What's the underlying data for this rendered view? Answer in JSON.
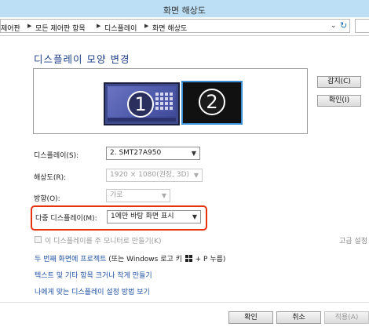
{
  "window": {
    "title": "화면 해상도"
  },
  "address_bar": {
    "crumbs": [
      "제어판",
      "모든 제어판 항목",
      "디스플레이",
      "화면 해상도"
    ]
  },
  "page": {
    "title": "디스플레이 모양 변경",
    "monitors": [
      {
        "number": "1"
      },
      {
        "number": "2"
      }
    ],
    "detect_label": "감지(C)",
    "identify_label": "확인(I)",
    "display_label": "디스플레이(S):",
    "display_value": "2. SMT27A950",
    "resolution_label": "해상도(R):",
    "resolution_value": "1920 × 1080(권장, 3D)",
    "orientation_label": "방향(O):",
    "orientation_value": "가로",
    "multi_display_label": "다중 디스플레이(M):",
    "multi_display_value": "1에만 바탕 화면 표시",
    "main_monitor_label": "이 디스플레이를 주 모니터로 만들기(K)",
    "advanced_label": "고급 설정",
    "links": {
      "project_link": "두 번째 화면에 프로젝트",
      "project_tail": " (또는 Windows 로고 키 ",
      "project_end": " + P 누름)",
      "text_size_link": "텍스트 및 기타 항목 크거나 작게 만들기",
      "help_link": "나에게 맞는 디스플레이 설정 방법 보기"
    }
  },
  "footer": {
    "ok_label": "확인",
    "cancel_label": "취소",
    "apply_label": "적용(A)"
  },
  "colors": {
    "accent": "#1e3f87",
    "link": "#1f52a3",
    "highlight": "#e8320c",
    "titlebar": "#bcdff5"
  }
}
